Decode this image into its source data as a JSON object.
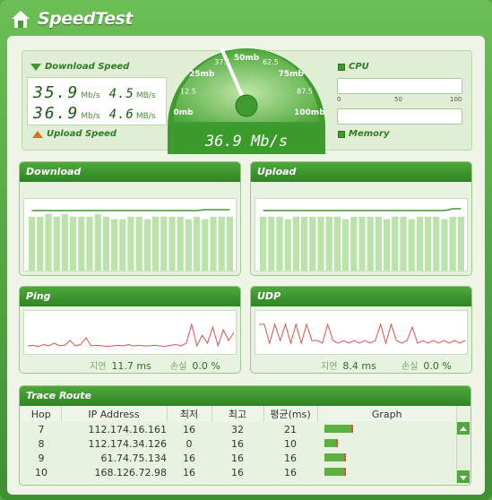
{
  "app": {
    "title": "SpeedTest"
  },
  "speed": {
    "download_label": "Download Speed",
    "upload_label": "Upload Speed",
    "rows": [
      {
        "big": "35.9",
        "big_unit": "Mb/s",
        "small": "4.5",
        "small_unit": "MB/s"
      },
      {
        "big": "36.9",
        "big_unit": "Mb/s",
        "small": "4.6",
        "small_unit": "MB/s"
      }
    ]
  },
  "gauge": {
    "value_text": "36.9 Mb/s",
    "needle_value": 36.9,
    "max": 100,
    "labels": [
      "0mb",
      "12.5",
      "25mb",
      "37.5",
      "50mb",
      "62.5",
      "75mb",
      "87.5",
      "100mb"
    ]
  },
  "system": {
    "cpu_label": "CPU",
    "memory_label": "Memory",
    "ticks": [
      "0",
      "50",
      "100"
    ],
    "cpu_percent": 0,
    "memory_percent": 0
  },
  "panels": {
    "download_title": "Download",
    "upload_title": "Upload",
    "ping_title": "Ping",
    "udp_title": "UDP",
    "ping_latency_label": "지연",
    "ping_latency_value": "11.7 ms",
    "ping_loss_label": "손실",
    "ping_loss_value": "0.0 %",
    "udp_latency_label": "지연",
    "udp_latency_value": "8.4 ms",
    "udp_loss_label": "손실",
    "udp_loss_value": "0.0 %"
  },
  "colors": {
    "accent": "#3f9a2f",
    "bar": "#b9e3a9",
    "line": "#e05050"
  },
  "trace": {
    "title": "Trace Route",
    "headers": [
      "Hop",
      "IP Address",
      "최저",
      "최고",
      "평균(ms)",
      "Graph"
    ],
    "rows": [
      {
        "hop": "7",
        "ip": "112.174.16.161",
        "min": "16",
        "max": "32",
        "avg": "21"
      },
      {
        "hop": "8",
        "ip": "112.174.34.126",
        "min": "0",
        "max": "16",
        "avg": "10"
      },
      {
        "hop": "9",
        "ip": "61.74.75.134",
        "min": "16",
        "max": "16",
        "avg": "16"
      },
      {
        "hop": "10",
        "ip": "168.126.72.98",
        "min": "16",
        "max": "16",
        "avg": "16"
      }
    ]
  }
}
